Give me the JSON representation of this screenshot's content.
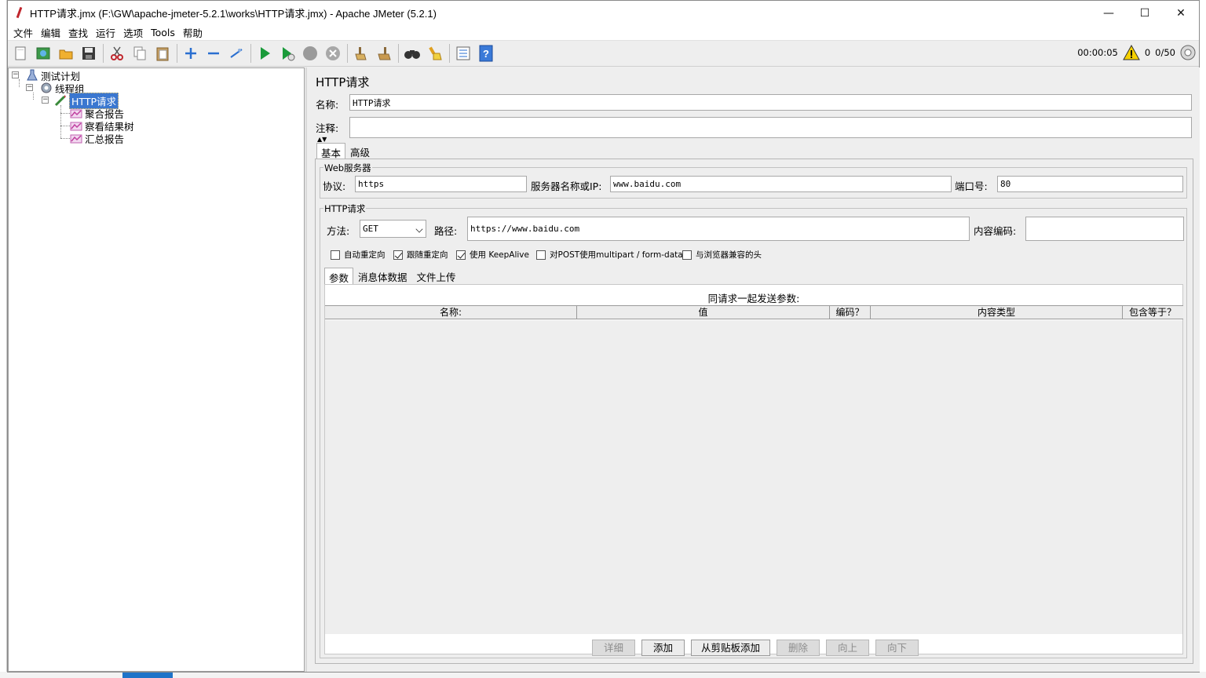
{
  "window": {
    "title": "HTTP请求.jmx (F:\\GW\\apache-jmeter-5.2.1\\works\\HTTP请求.jmx) - Apache JMeter (5.2.1)",
    "minimize": "—",
    "maximize": "☐",
    "close": "✕"
  },
  "menu": {
    "items": [
      "文件",
      "编辑",
      "查找",
      "运行",
      "选项",
      "Tools",
      "帮助"
    ]
  },
  "toolbar": {
    "elapsed": "00:00:05",
    "warnings": "0",
    "threads": "0/50",
    "icons": [
      "new-icon",
      "templates-icon",
      "open-icon",
      "save-icon",
      "cut-icon",
      "copy-icon",
      "paste-icon",
      "expand-icon",
      "collapse-icon",
      "toggle-icon",
      "start-icon",
      "start-no-pause-icon",
      "stop-icon",
      "shutdown-icon",
      "clear-icon",
      "clear-all-icon",
      "search-icon",
      "reset-search-icon",
      "function-helper-icon",
      "help-icon"
    ]
  },
  "tree": {
    "test_plan": "测试计划",
    "thread_group": "线程组",
    "http_request": "HTTP请求",
    "aggregate_report": "聚合报告",
    "view_results_tree": "察看结果树",
    "summary_report": "汇总报告"
  },
  "editor": {
    "title": "HTTP请求",
    "name_label": "名称:",
    "name_value": "HTTP请求",
    "comment_label": "注释:",
    "comment_value": "",
    "tabs": [
      "基本",
      "高级"
    ],
    "web_server": {
      "group_title": "Web服务器",
      "protocol_label": "协议:",
      "protocol_value": "https",
      "server_label": "服务器名称或IP:",
      "server_value": "www.baidu.com",
      "port_label": "端口号:",
      "port_value": "80"
    },
    "http_request": {
      "group_title": "HTTP请求",
      "method_label": "方法:",
      "method_value": "GET",
      "path_label": "路径:",
      "path_value": "https://www.baidu.com",
      "encoding_label": "内容编码:",
      "encoding_value": ""
    },
    "checkboxes": [
      {
        "label": "自动重定向",
        "checked": false
      },
      {
        "label": "跟随重定向",
        "checked": true
      },
      {
        "label": "使用 KeepAlive",
        "checked": true
      },
      {
        "label": "对POST使用multipart / form-data",
        "checked": false
      },
      {
        "label": "与浏览器兼容的头",
        "checked": false
      }
    ],
    "sub_tabs": [
      "参数",
      "消息体数据",
      "文件上传"
    ],
    "params": {
      "caption": "同请求一起发送参数:",
      "columns": [
        "名称:",
        "值",
        "编码？",
        "内容类型",
        "包含等于？"
      ]
    },
    "buttons": {
      "detail": "详细",
      "add": "添加",
      "add_from_clipboard": "从剪贴板添加",
      "delete": "删除",
      "up": "向上",
      "down": "向下"
    }
  }
}
